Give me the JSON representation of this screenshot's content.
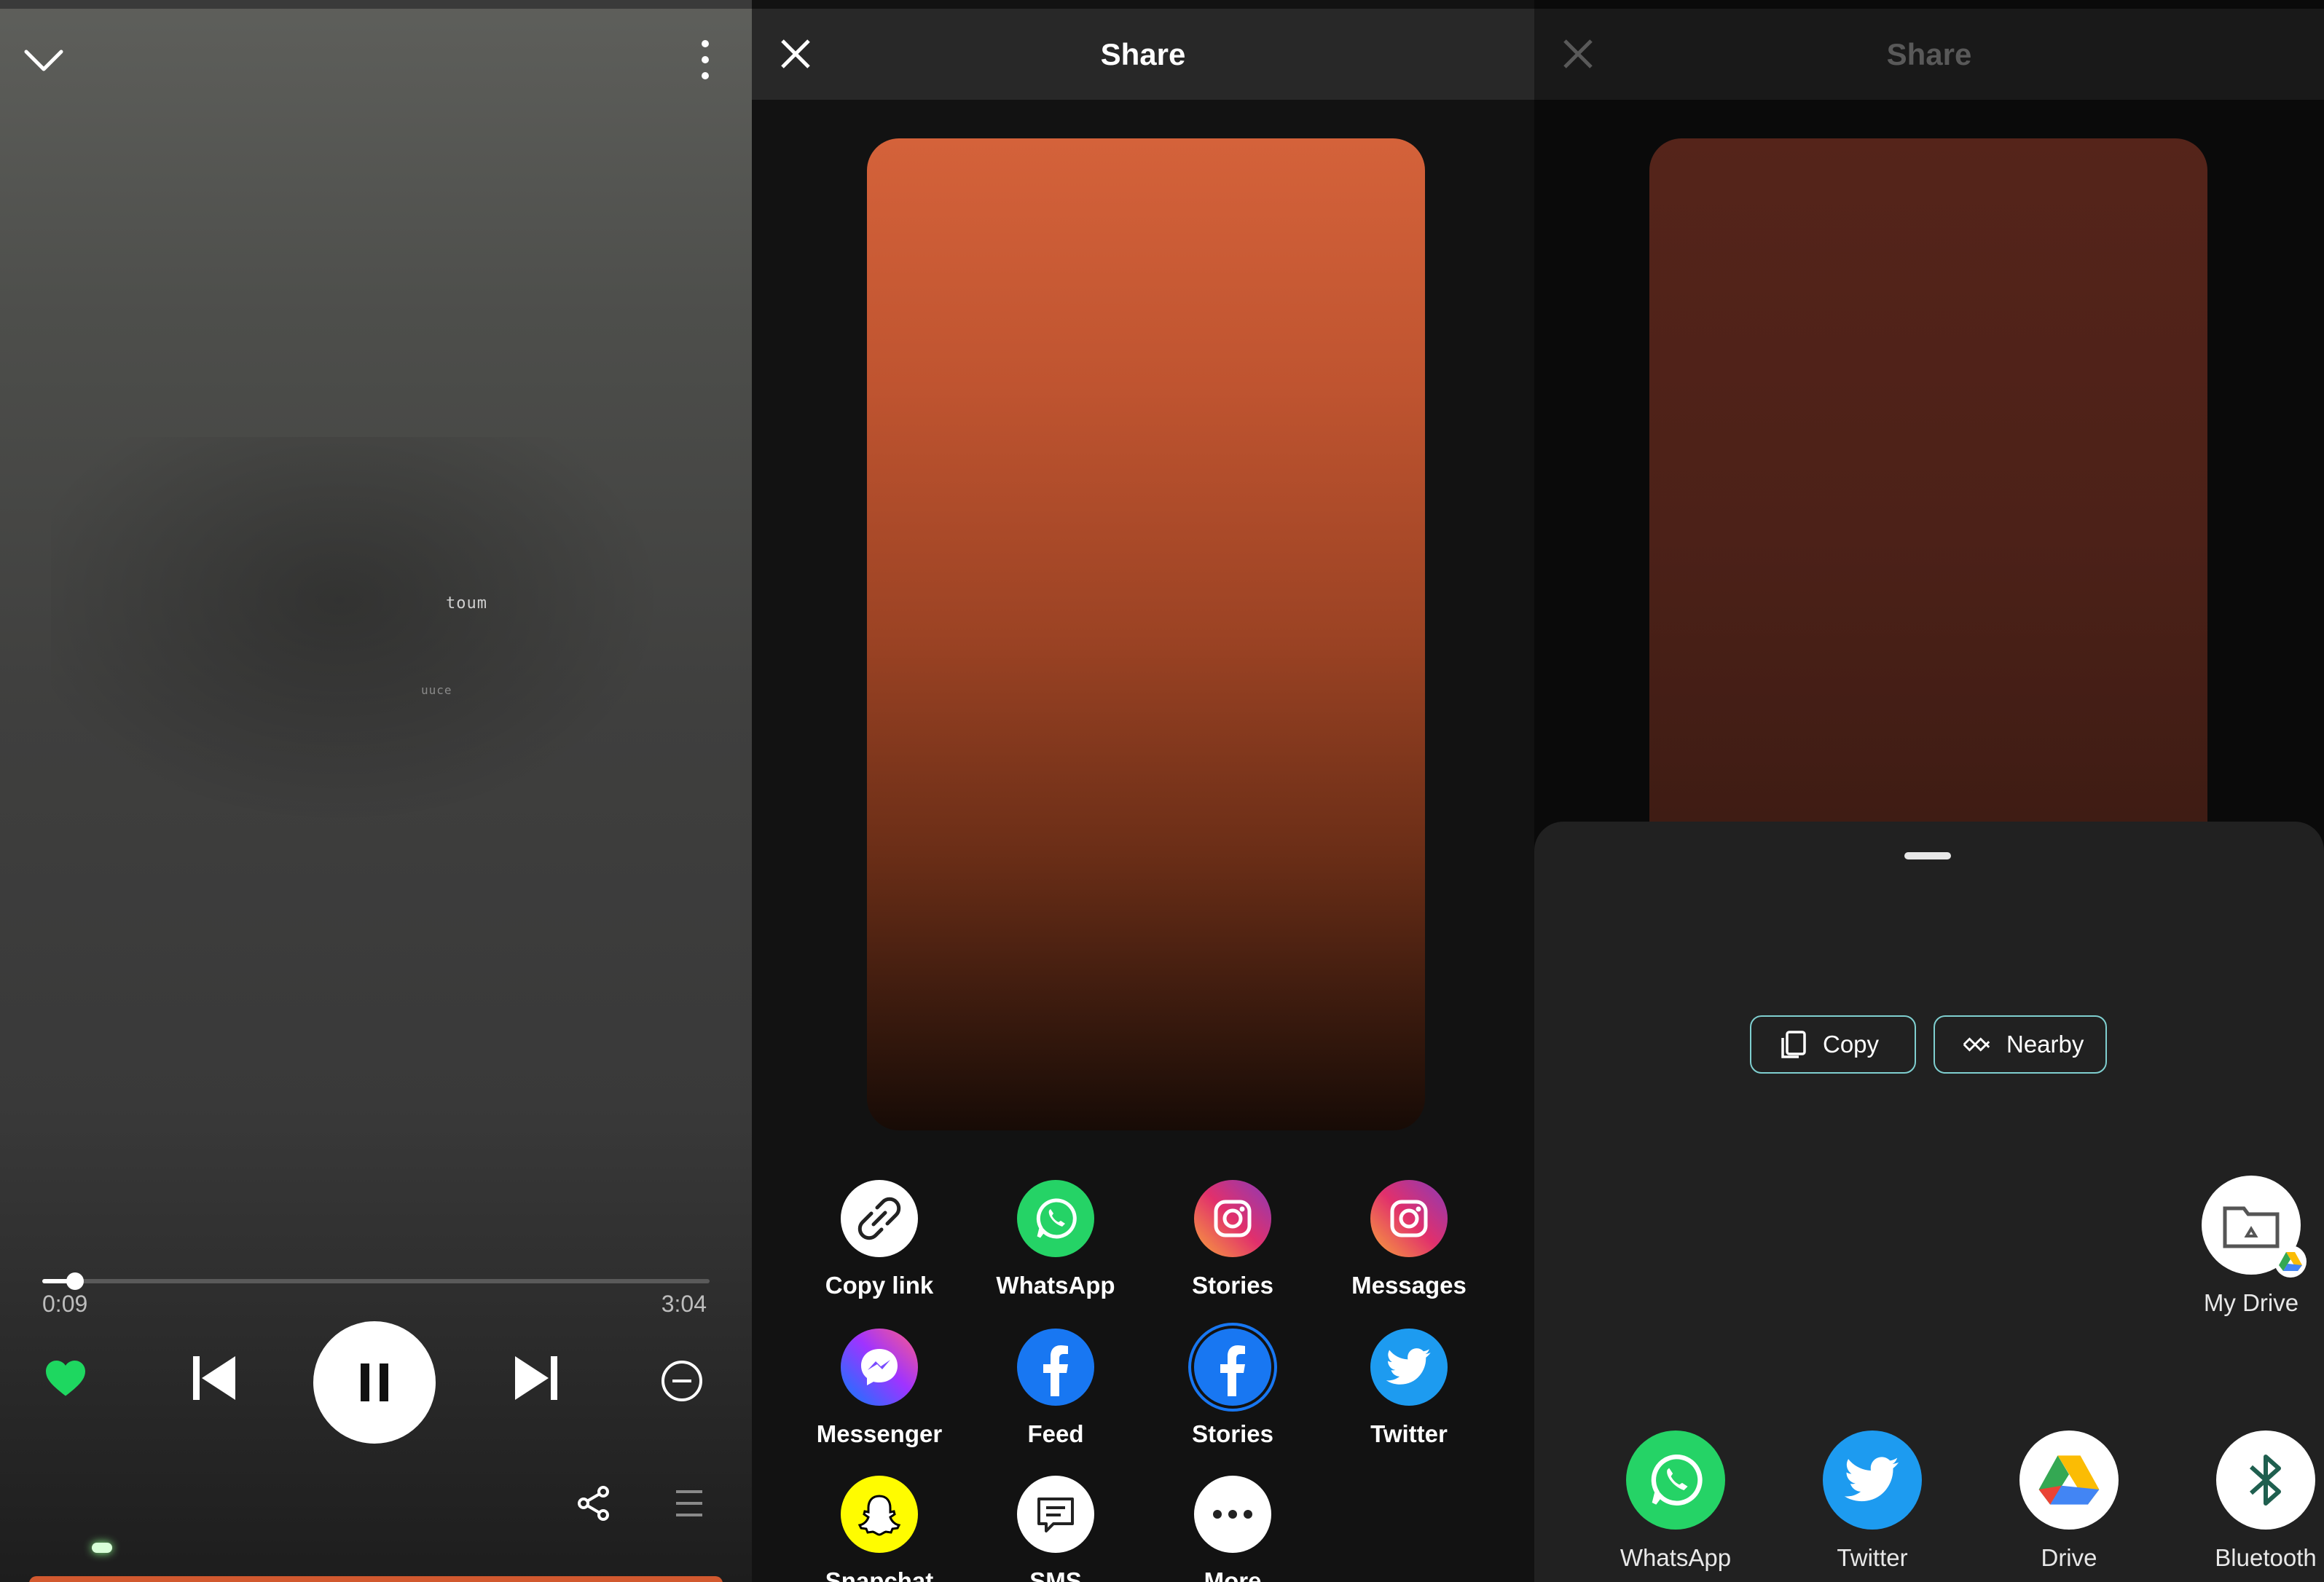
{
  "player": {
    "elapsed": "0:09",
    "duration": "3:04",
    "progress_fraction": 0.049,
    "art_text": [
      "toum",
      "uuce"
    ]
  },
  "share_panel": {
    "title": "Share",
    "apps": [
      {
        "label": "Copy link",
        "icon": "link-icon"
      },
      {
        "label": "WhatsApp",
        "icon": "whatsapp-icon"
      },
      {
        "label": "Stories",
        "icon": "instagram-icon"
      },
      {
        "label": "Messages",
        "icon": "instagram-icon"
      },
      {
        "label": "Messenger",
        "icon": "messenger-icon"
      },
      {
        "label": "Feed",
        "icon": "facebook-icon"
      },
      {
        "label": "Stories",
        "icon": "facebook-stories-icon"
      },
      {
        "label": "Twitter",
        "icon": "twitter-icon"
      },
      {
        "label": "Snapchat",
        "icon": "snapchat-icon"
      },
      {
        "label": "SMS",
        "icon": "sms-icon"
      },
      {
        "label": "More",
        "icon": "more-icon"
      }
    ]
  },
  "system_sheet": {
    "title": "Share",
    "chips": [
      {
        "label": "Copy",
        "icon": "copy-icon"
      },
      {
        "label": "Nearby",
        "icon": "nearby-icon"
      }
    ],
    "direct_target": {
      "label": "My Drive",
      "icon": "drive-folder-icon"
    },
    "apps": [
      {
        "label": "WhatsApp",
        "icon": "whatsapp-icon"
      },
      {
        "label": "Twitter",
        "icon": "twitter-icon"
      },
      {
        "label": "Drive",
        "icon": "drive-icon"
      },
      {
        "label": "Bluetooth",
        "icon": "bluetooth-icon"
      }
    ]
  },
  "colors": {
    "spotify_green": "#1ed760",
    "whatsapp_green": "#25d366",
    "twitter_blue": "#1d9bf0",
    "facebook_blue": "#1877f2",
    "snapchat_yellow": "#fffc00",
    "chip_outline": "#7fcfd0"
  }
}
